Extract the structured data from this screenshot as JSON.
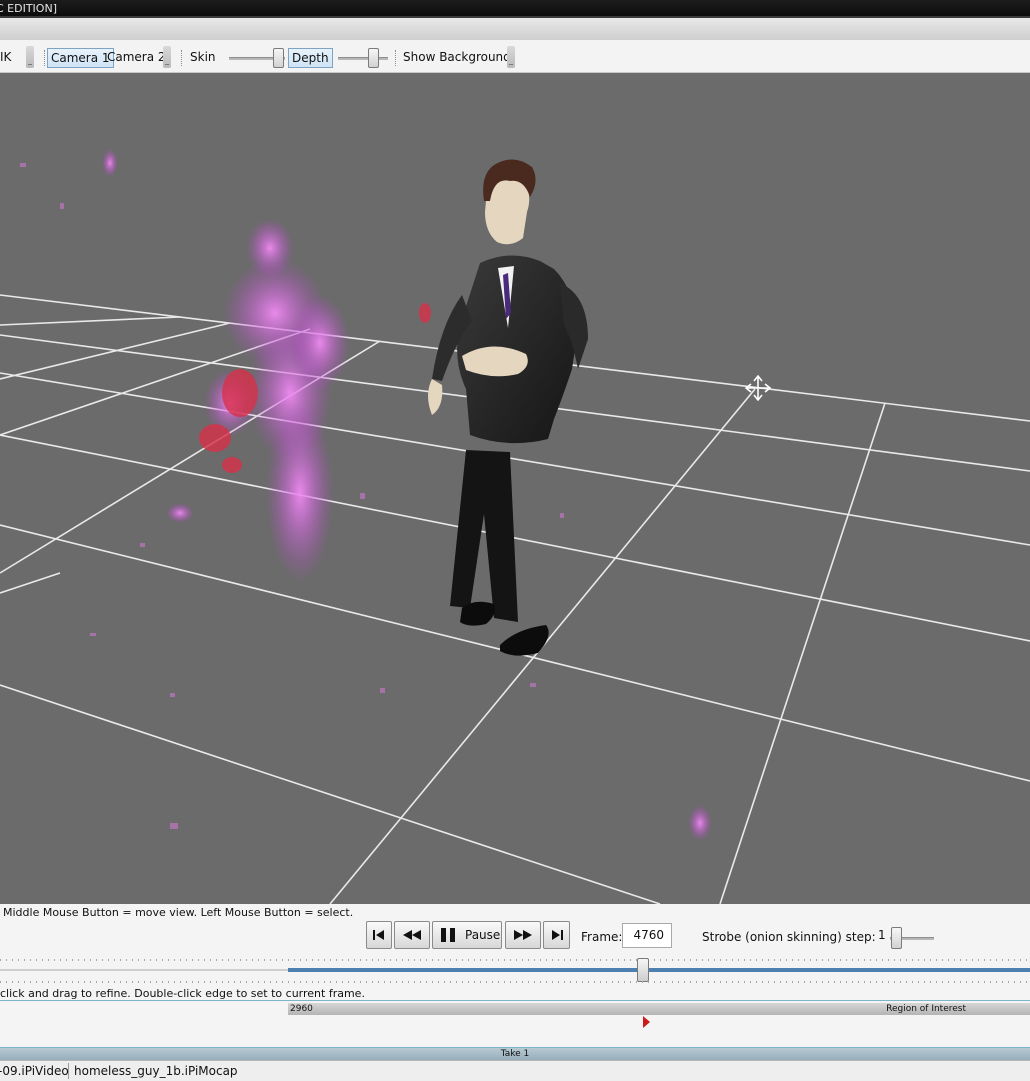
{
  "window": {
    "title_fragment": "C EDITION]"
  },
  "toolbar": {
    "ik_label": "IK",
    "camera1_label": "Camera 1",
    "camera2_label": "Camera 2",
    "skin_label": "Skin",
    "depth_label": "Depth",
    "show_background_label": "Show Background"
  },
  "viewport": {
    "background_color": "#6b6b6b",
    "grid_color": "#f0f0f0",
    "pointcloud_color": "#e35de8"
  },
  "playback": {
    "hint": "Middle Mouse Button = move view. Left Mouse Button = select.",
    "pause_label": "Pause",
    "frame_label": "Frame:",
    "frame_value": "4760",
    "strobe_label": "Strobe (onion skinning) step:",
    "strobe_value": "1"
  },
  "timeline": {
    "hint": "click and drag to refine. Double-click edge to set to current frame.",
    "roi_start": "2960",
    "roi_label": "Region of Interest",
    "take_label": "Take 1",
    "accent_color": "#4d7fb0",
    "marker_color": "#cc1b1b"
  },
  "statusbar": {
    "video_file": "-09.iPiVideo",
    "project_file": "homeless_guy_1b.iPiMocap"
  }
}
